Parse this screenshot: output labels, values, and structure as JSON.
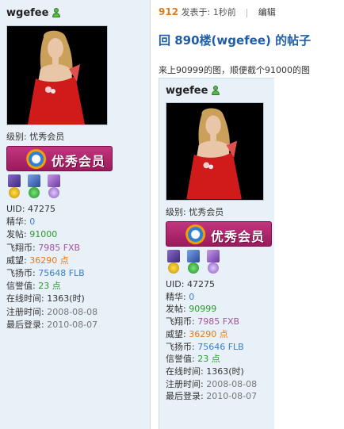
{
  "profile": {
    "username": "wgefee",
    "level": "级别: 忧秀会员",
    "badge_text": "优秀会员",
    "stats": [
      {
        "label": "UID: ",
        "value": "47275",
        "tone": ""
      },
      {
        "label": "精华: ",
        "value": "0",
        "tone": "v-blue"
      },
      {
        "label": "发帖: ",
        "value": "91000",
        "tone": "v-green"
      },
      {
        "label": "飞翔币: ",
        "value": "7985 FXB",
        "tone": "v-purple"
      },
      {
        "label": "威望: ",
        "value": "36290 点",
        "tone": "v-orange"
      },
      {
        "label": "飞扬币: ",
        "value": "75648 FLB",
        "tone": "v-blue"
      },
      {
        "label": "信誉值: ",
        "value": "23 点",
        "tone": "v-green"
      },
      {
        "label": "在线时间: ",
        "value": "1363(时)",
        "tone": ""
      },
      {
        "label": "注册时间: ",
        "value": "2008-08-08",
        "tone": "v-grey"
      },
      {
        "label": "最后登录: ",
        "value": "2010-08-07",
        "tone": "v-grey"
      }
    ]
  },
  "post": {
    "floor": "912",
    "posted_label": "发表于: 1秒前",
    "edit_label": "编辑",
    "title": "回  890楼(wgefee) 的帖子",
    "content": "来上90999的图，顺便截个91000的图"
  },
  "quoted_profile": {
    "username": "wgefee",
    "level": "级别: 忧秀会员",
    "badge_text": "优秀会员",
    "stats": [
      {
        "label": "UID: ",
        "value": "47275",
        "tone": ""
      },
      {
        "label": "精华: ",
        "value": "0",
        "tone": "v-blue"
      },
      {
        "label": "发帖: ",
        "value": "90999",
        "tone": "v-green"
      },
      {
        "label": "飞翔币: ",
        "value": "7985 FXB",
        "tone": "v-purple"
      },
      {
        "label": "威望: ",
        "value": "36290 点",
        "tone": "v-orange"
      },
      {
        "label": "飞扬币: ",
        "value": "75646 FLB",
        "tone": "v-blue"
      },
      {
        "label": "信誉值: ",
        "value": "23 点",
        "tone": "v-green"
      },
      {
        "label": "在线时间: ",
        "value": "1363(时)",
        "tone": ""
      },
      {
        "label": "注册时间: ",
        "value": "2008-08-08",
        "tone": "v-grey"
      },
      {
        "label": "最后登录: ",
        "value": "2010-08-07",
        "tone": "v-grey"
      }
    ]
  },
  "colors": {
    "sidebar_bg": "#e8f0f8",
    "title_blue": "#1e5ea8",
    "floor_orange": "#e07a1f",
    "badge_magenta": "#b02a70"
  }
}
